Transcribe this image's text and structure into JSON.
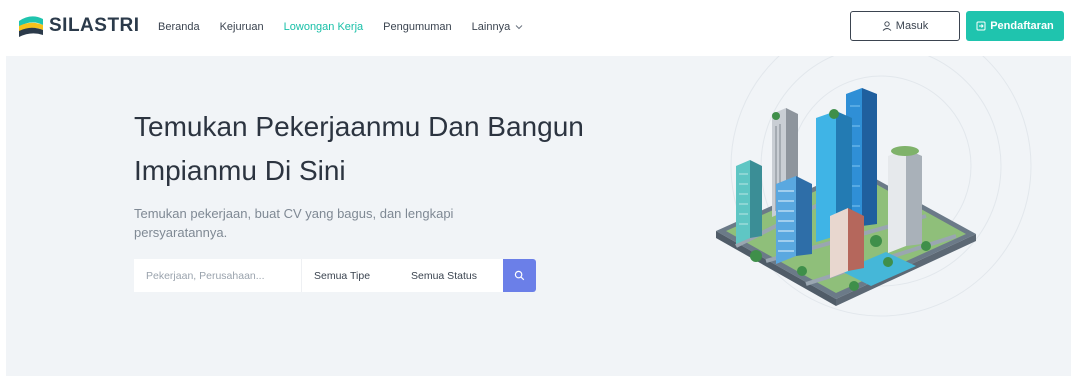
{
  "brand": {
    "name": "SILASTRI"
  },
  "nav": {
    "items": [
      {
        "label": "Beranda",
        "active": false
      },
      {
        "label": "Kejuruan",
        "active": false
      },
      {
        "label": "Lowongan Kerja",
        "active": true
      },
      {
        "label": "Pengumuman",
        "active": false
      },
      {
        "label": "Lainnya",
        "active": false,
        "dropdown": true
      }
    ],
    "login_label": "Masuk",
    "register_label": "Pendaftaran"
  },
  "hero": {
    "title": "Temukan Pekerjaanmu Dan Bangun Impianmu Di Sini",
    "subtitle": "Temukan pekerjaan, buat CV yang bagus, dan lengkapi persyaratannya."
  },
  "search": {
    "placeholder": "Pekerjaan, Perusahaan...",
    "value": "",
    "type_select": "Semua Tipe",
    "status_select": "Semua Status",
    "button_icon": "search-icon"
  },
  "colors": {
    "accent": "#1fc4ae",
    "active_nav": "#19c0a8",
    "search_button": "#6b7fe8",
    "hero_bg": "#f1f4f7",
    "title_text": "#2c3440"
  }
}
